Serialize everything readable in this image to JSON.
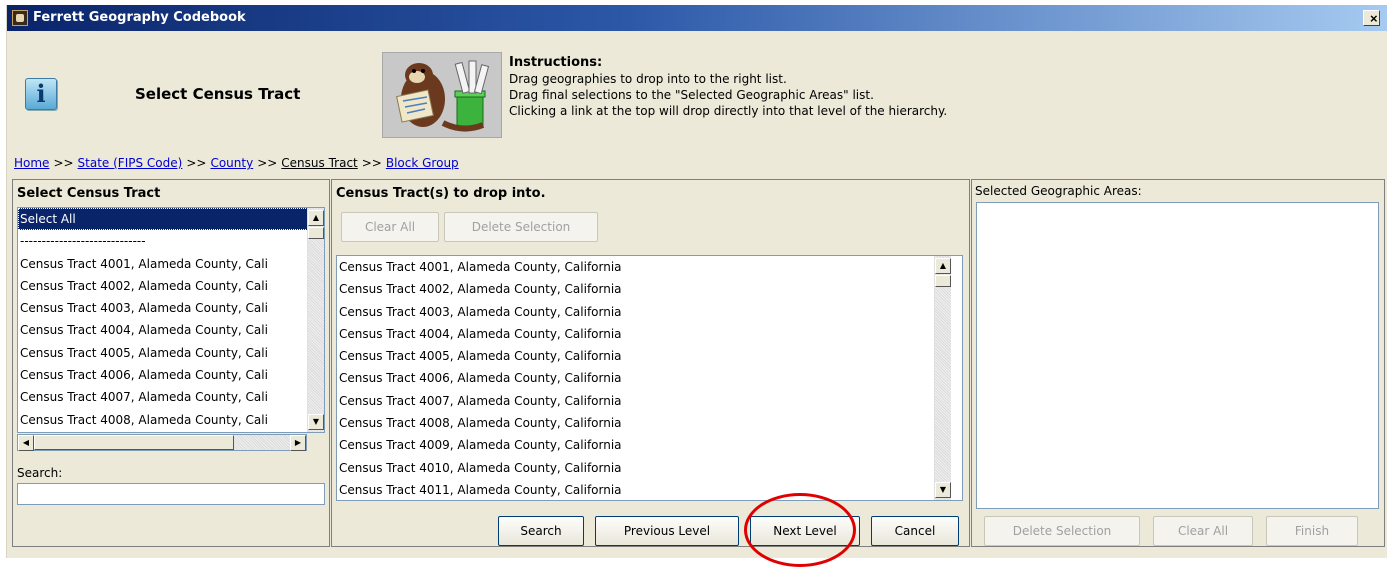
{
  "window": {
    "title": "Ferrett Geography Codebook",
    "close_label": "×"
  },
  "header": {
    "icon_letter": "i",
    "heading": "Select Census Tract",
    "instructions": {
      "title": "Instructions:",
      "lines": [
        "Drag geographies to drop into to the right list.",
        "Drag final selections to the \"Selected Geographic Areas\" list.",
        "Clicking a link at the top will drop directly into that level of the hierarchy."
      ]
    }
  },
  "breadcrumb": {
    "sep": ">>",
    "items": [
      {
        "label": "Home"
      },
      {
        "label": "State (FIPS Code)"
      },
      {
        "label": "County"
      },
      {
        "label": "Census Tract"
      },
      {
        "label": "Block Group"
      }
    ]
  },
  "left_panel": {
    "title": "Select Census Tract",
    "items": [
      "Select All",
      "-----------------------------",
      "Census Tract 4001, Alameda County, Cali",
      "Census Tract 4002, Alameda County, Cali",
      "Census Tract 4003, Alameda County, Cali",
      "Census Tract 4004, Alameda County, Cali",
      "Census Tract 4005, Alameda County, Cali",
      "Census Tract 4006, Alameda County, Cali",
      "Census Tract 4007, Alameda County, Cali",
      "Census Tract 4008, Alameda County, Cali"
    ],
    "selected_index": 0,
    "search_label": "Search:",
    "search_value": ""
  },
  "middle_panel": {
    "title": "Census Tract(s) to drop into.",
    "clear_all_label": "Clear All",
    "delete_selection_label": "Delete Selection",
    "items": [
      "Census Tract 4001, Alameda County, California",
      "Census Tract 4002, Alameda County, California",
      "Census Tract 4003, Alameda County, California",
      "Census Tract 4004, Alameda County, California",
      "Census Tract 4005, Alameda County, California",
      "Census Tract 4006, Alameda County, California",
      "Census Tract 4007, Alameda County, California",
      "Census Tract 4008, Alameda County, California",
      "Census Tract 4009, Alameda County, California",
      "Census Tract 4010, Alameda County, California",
      "Census Tract 4011, Alameda County, California"
    ],
    "buttons": {
      "search": "Search",
      "previous_level": "Previous Level",
      "next_level": "Next Level",
      "cancel": "Cancel"
    }
  },
  "right_panel": {
    "title": "Selected Geographic Areas:",
    "buttons": {
      "delete_selection": "Delete Selection",
      "clear_all": "Clear All",
      "finish": "Finish"
    }
  },
  "colors": {
    "highlight_ring": "#e00000",
    "selection": "#0a246a",
    "link": "#0000cc"
  }
}
